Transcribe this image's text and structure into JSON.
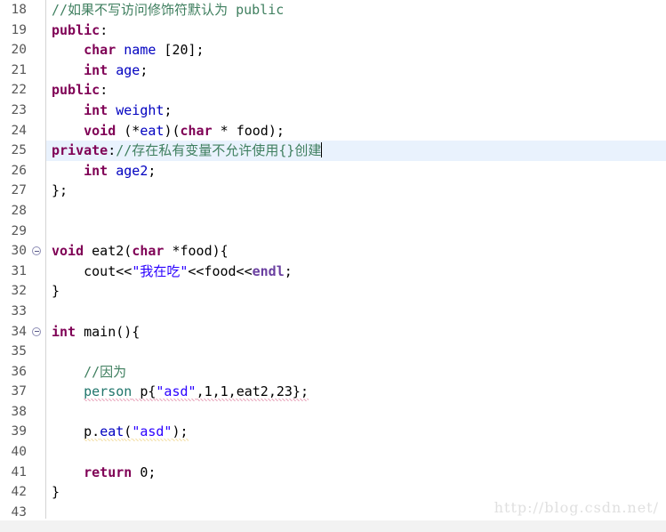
{
  "editor": {
    "language": "C++",
    "first_line_number": 18,
    "current_line_number": 25,
    "colors": {
      "keyword": "#7f0055",
      "comment": "#3f7f5f",
      "string": "#2a00ff",
      "field": "#0000c0",
      "type": "#20756b",
      "macro": "#6a3fa0",
      "current_line_background": "#e9f2fd",
      "error_underline": "#c0003c",
      "warning_underline": "#e0a200",
      "gutter_text": "#585858"
    }
  },
  "watermark": {
    "text": "http://blog.csdn.net/"
  },
  "lines": [
    {
      "num": "18",
      "fold": false,
      "current": false,
      "tokens": [
        {
          "t": "//如果不写访问修饰符默认为 public",
          "c": "cmt"
        }
      ]
    },
    {
      "num": "19",
      "fold": false,
      "current": false,
      "tokens": [
        {
          "t": "public",
          "c": "kw"
        },
        {
          "t": ":",
          "c": "pun"
        }
      ]
    },
    {
      "num": "20",
      "fold": false,
      "current": false,
      "tokens": [
        {
          "t": "    ",
          "c": "pun"
        },
        {
          "t": "char",
          "c": "kw"
        },
        {
          "t": " ",
          "c": "pun"
        },
        {
          "t": "name",
          "c": "fld"
        },
        {
          "t": " [20];",
          "c": "pun"
        }
      ]
    },
    {
      "num": "21",
      "fold": false,
      "current": false,
      "tokens": [
        {
          "t": "    ",
          "c": "pun"
        },
        {
          "t": "int",
          "c": "kw"
        },
        {
          "t": " ",
          "c": "pun"
        },
        {
          "t": "age",
          "c": "fld"
        },
        {
          "t": ";",
          "c": "pun"
        }
      ]
    },
    {
      "num": "22",
      "fold": false,
      "current": false,
      "tokens": [
        {
          "t": "public",
          "c": "kw"
        },
        {
          "t": ":",
          "c": "pun"
        }
      ]
    },
    {
      "num": "23",
      "fold": false,
      "current": false,
      "tokens": [
        {
          "t": "    ",
          "c": "pun"
        },
        {
          "t": "int",
          "c": "kw"
        },
        {
          "t": " ",
          "c": "pun"
        },
        {
          "t": "weight",
          "c": "fld"
        },
        {
          "t": ";",
          "c": "pun"
        }
      ]
    },
    {
      "num": "24",
      "fold": false,
      "current": false,
      "tokens": [
        {
          "t": "    ",
          "c": "pun"
        },
        {
          "t": "void",
          "c": "kw"
        },
        {
          "t": " (*",
          "c": "pun"
        },
        {
          "t": "eat",
          "c": "fld"
        },
        {
          "t": ")(",
          "c": "pun"
        },
        {
          "t": "char",
          "c": "kw"
        },
        {
          "t": " * food);",
          "c": "pun"
        }
      ]
    },
    {
      "num": "25",
      "fold": false,
      "current": true,
      "tokens": [
        {
          "t": "private",
          "c": "kw"
        },
        {
          "t": ":",
          "c": "pun"
        },
        {
          "t": "//存在私有变量不允许使用{}创建",
          "c": "cmt"
        }
      ],
      "caret": true
    },
    {
      "num": "26",
      "fold": false,
      "current": false,
      "tokens": [
        {
          "t": "    ",
          "c": "pun"
        },
        {
          "t": "int",
          "c": "kw"
        },
        {
          "t": " ",
          "c": "pun"
        },
        {
          "t": "age2",
          "c": "fld"
        },
        {
          "t": ";",
          "c": "pun"
        }
      ]
    },
    {
      "num": "27",
      "fold": false,
      "current": false,
      "tokens": [
        {
          "t": "};",
          "c": "pun"
        }
      ]
    },
    {
      "num": "28",
      "fold": false,
      "current": false,
      "tokens": []
    },
    {
      "num": "29",
      "fold": false,
      "current": false,
      "tokens": []
    },
    {
      "num": "30",
      "fold": true,
      "current": false,
      "tokens": [
        {
          "t": "void",
          "c": "kw"
        },
        {
          "t": " eat2(",
          "c": "pun"
        },
        {
          "t": "char",
          "c": "kw"
        },
        {
          "t": " *food){",
          "c": "pun"
        }
      ]
    },
    {
      "num": "31",
      "fold": false,
      "current": false,
      "tokens": [
        {
          "t": "    cout<<",
          "c": "pun"
        },
        {
          "t": "\"我在吃\"",
          "c": "str"
        },
        {
          "t": "<<food<<",
          "c": "pun"
        },
        {
          "t": "endl",
          "c": "mac"
        },
        {
          "t": ";",
          "c": "pun"
        }
      ]
    },
    {
      "num": "32",
      "fold": false,
      "current": false,
      "tokens": [
        {
          "t": "}",
          "c": "pun"
        }
      ]
    },
    {
      "num": "33",
      "fold": false,
      "current": false,
      "tokens": []
    },
    {
      "num": "34",
      "fold": true,
      "current": false,
      "tokens": [
        {
          "t": "int",
          "c": "kw"
        },
        {
          "t": " main(){",
          "c": "pun"
        }
      ]
    },
    {
      "num": "35",
      "fold": false,
      "current": false,
      "tokens": []
    },
    {
      "num": "36",
      "fold": false,
      "current": false,
      "tokens": [
        {
          "t": "    ",
          "c": "pun"
        },
        {
          "t": "//因为",
          "c": "cmt"
        }
      ]
    },
    {
      "num": "37",
      "fold": false,
      "current": false,
      "tokens": [
        {
          "t": "    ",
          "c": "pun"
        },
        {
          "t": "person",
          "c": "typ err"
        },
        {
          "t": " p{",
          "c": "pun err"
        },
        {
          "t": "\"asd\"",
          "c": "str err"
        },
        {
          "t": ",1,1,eat2,23};",
          "c": "pun err"
        }
      ]
    },
    {
      "num": "38",
      "fold": false,
      "current": false,
      "tokens": []
    },
    {
      "num": "39",
      "fold": false,
      "current": false,
      "tokens": [
        {
          "t": "    ",
          "c": "pun"
        },
        {
          "t": "p.",
          "c": "pun warn"
        },
        {
          "t": "eat",
          "c": "fld warn"
        },
        {
          "t": "(",
          "c": "pun warn"
        },
        {
          "t": "\"asd\"",
          "c": "str warn"
        },
        {
          "t": ");",
          "c": "pun warn"
        }
      ]
    },
    {
      "num": "40",
      "fold": false,
      "current": false,
      "tokens": []
    },
    {
      "num": "41",
      "fold": false,
      "current": false,
      "tokens": [
        {
          "t": "    ",
          "c": "pun"
        },
        {
          "t": "return",
          "c": "kw"
        },
        {
          "t": " 0;",
          "c": "pun"
        }
      ]
    },
    {
      "num": "42",
      "fold": false,
      "current": false,
      "tokens": [
        {
          "t": "}",
          "c": "pun"
        }
      ]
    },
    {
      "num": "43",
      "fold": false,
      "current": false,
      "tokens": []
    }
  ]
}
